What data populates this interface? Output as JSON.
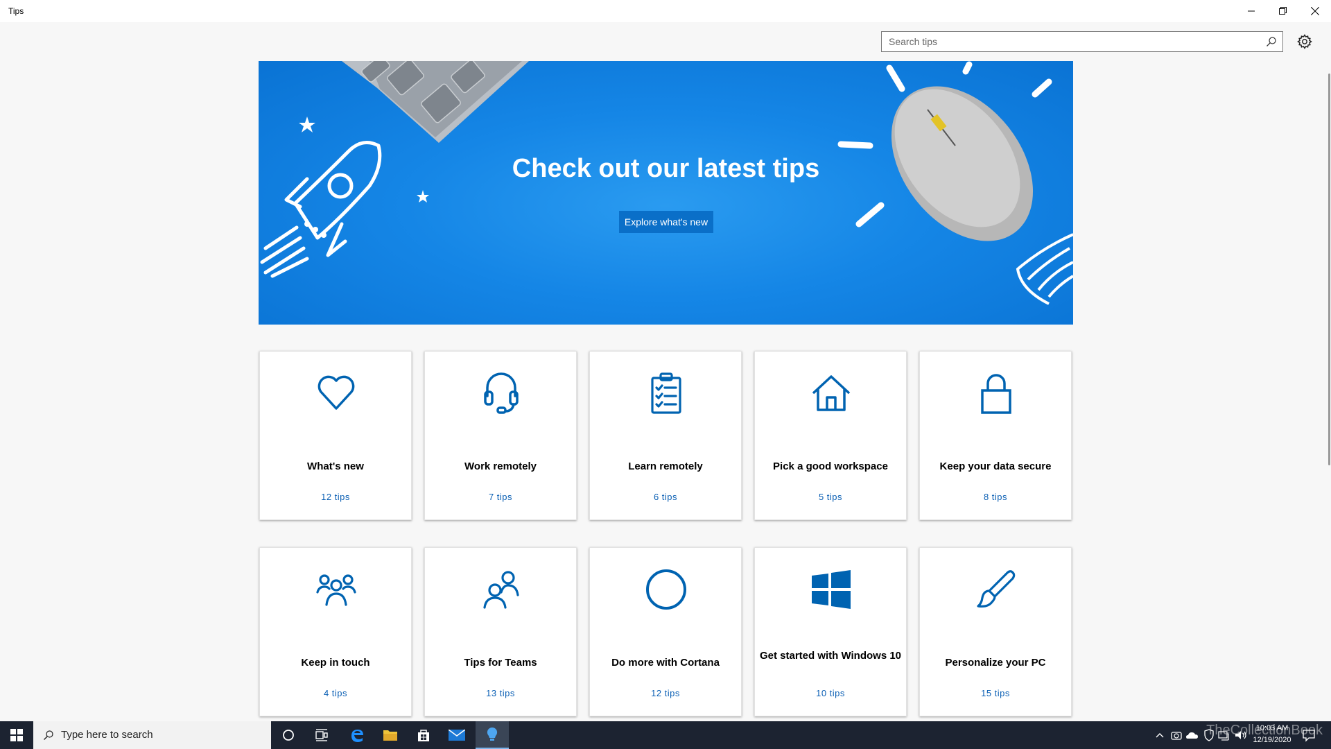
{
  "window": {
    "title": "Tips"
  },
  "search": {
    "placeholder": "Search tips"
  },
  "hero": {
    "title": "Check out our latest tips",
    "button_label": "Explore what's new"
  },
  "cards": [
    {
      "title": "What's new",
      "count": "12 tips",
      "icon": "heart-icon"
    },
    {
      "title": "Work remotely",
      "count": "7 tips",
      "icon": "headset-icon"
    },
    {
      "title": "Learn remotely",
      "count": "6 tips",
      "icon": "clipboard-checklist-icon"
    },
    {
      "title": "Pick a good workspace",
      "count": "5 tips",
      "icon": "home-icon"
    },
    {
      "title": "Keep your data secure",
      "count": "8 tips",
      "icon": "lock-icon"
    },
    {
      "title": "Keep in touch",
      "count": "4 tips",
      "icon": "people-group-icon"
    },
    {
      "title": "Tips for Teams",
      "count": "13 tips",
      "icon": "people-pair-icon"
    },
    {
      "title": "Do more with Cortana",
      "count": "12 tips",
      "icon": "cortana-circle-icon"
    },
    {
      "title": "Get started with Windows 10",
      "count": "10 tips",
      "icon": "windows-logo-icon"
    },
    {
      "title": "Personalize your PC",
      "count": "15 tips",
      "icon": "paintbrush-icon"
    }
  ],
  "taskbar": {
    "search_placeholder": "Type here to search",
    "clock_time": "10:03 AM",
    "clock_date": "12/19/2020",
    "watermark": "TheCollectionBook"
  },
  "colors": {
    "accent": "#0063b1",
    "hero_blue": "#1586e6",
    "taskbar": "#1c2331"
  }
}
